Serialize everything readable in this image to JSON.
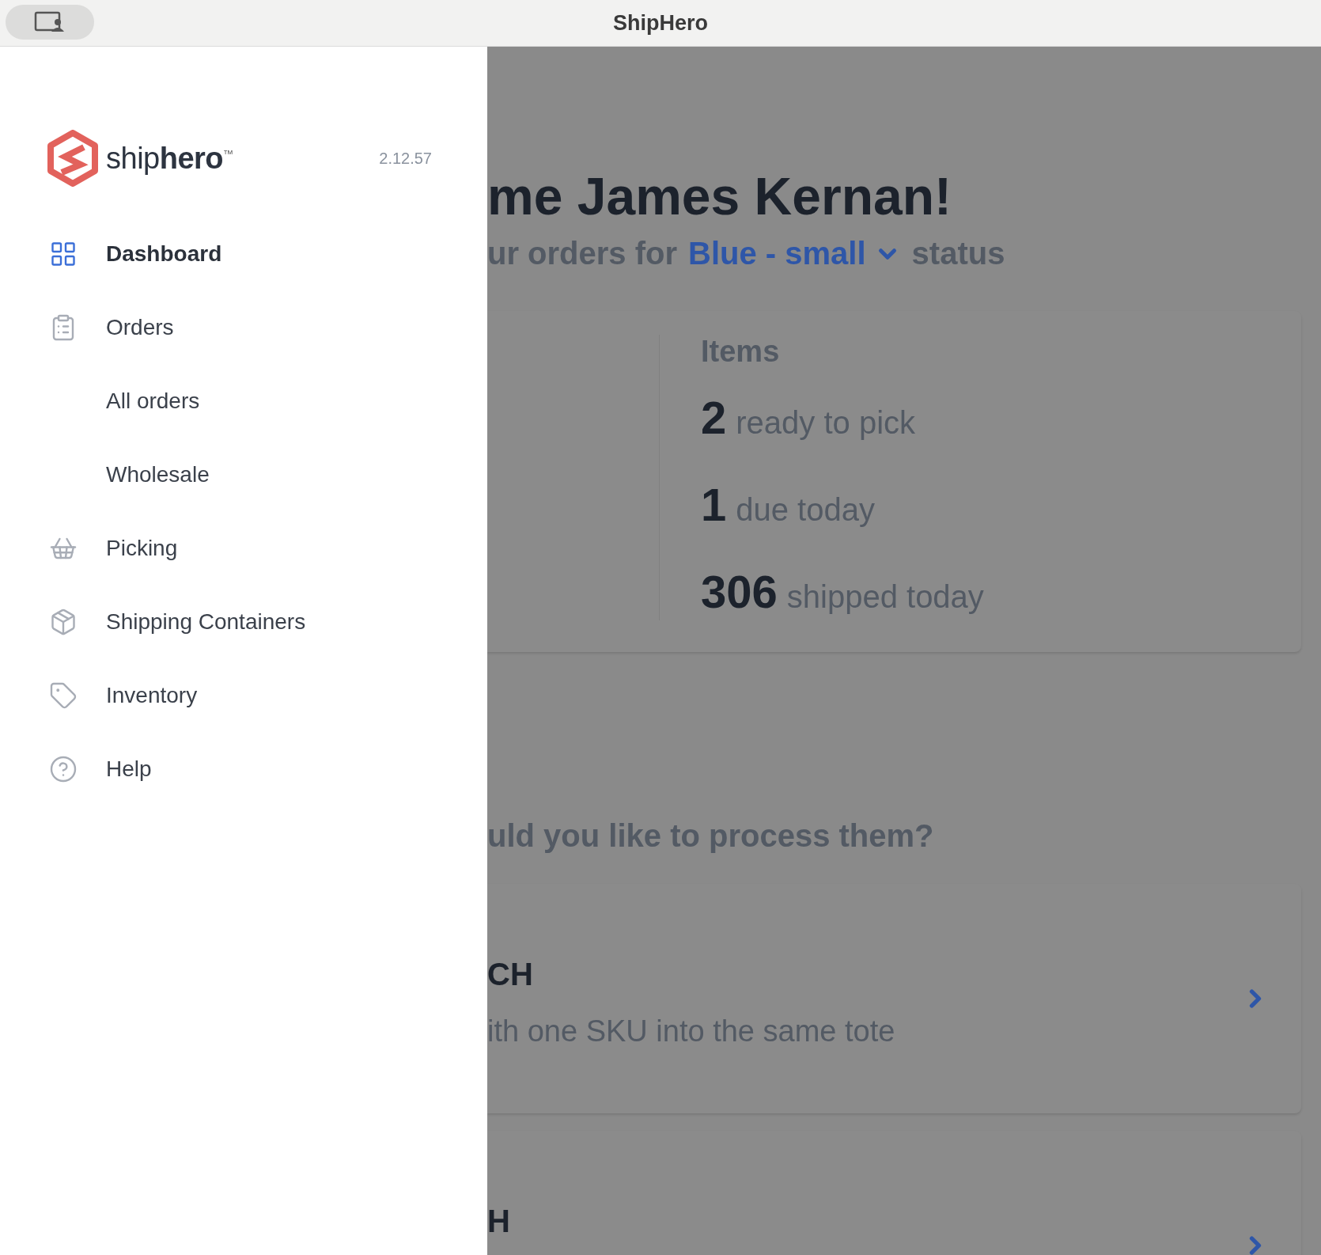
{
  "window": {
    "title": "ShipHero"
  },
  "sidebar": {
    "logo": {
      "light": "ship",
      "bold": "hero",
      "mark": "™"
    },
    "version": "2.12.57",
    "items": [
      {
        "label": "Dashboard",
        "selected": true
      },
      {
        "label": "Orders",
        "selected": false,
        "children": [
          {
            "label": "All orders",
            "selected": false
          },
          {
            "label": "Wholesale",
            "selected": false
          }
        ]
      },
      {
        "label": "Picking",
        "selected": false
      },
      {
        "label": "Shipping Containers",
        "selected": false
      },
      {
        "label": "Inventory",
        "selected": false
      },
      {
        "label": "Help",
        "selected": false
      }
    ]
  },
  "main": {
    "heading": "me James Kernan!",
    "subtitle": {
      "before": "ur orders for",
      "dropdown": "Blue - small",
      "after": "status"
    },
    "stats": {
      "title": "Items",
      "rows": [
        {
          "count": "2",
          "label": "ready to pick"
        },
        {
          "count": "1",
          "label": "due today"
        },
        {
          "count": "306",
          "label": "shipped today"
        }
      ]
    },
    "question": "uld you like to process them?",
    "options": [
      {
        "title": "CH",
        "description": "ith one SKU into the same tote"
      },
      {
        "title": "H"
      }
    ]
  }
}
